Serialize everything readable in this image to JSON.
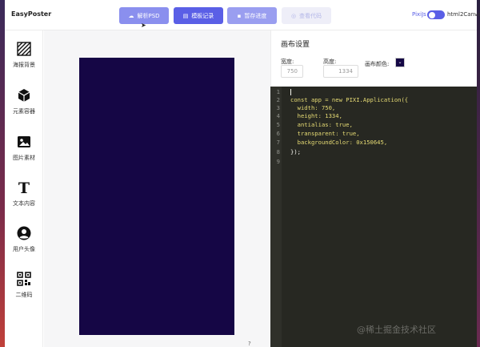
{
  "app": {
    "title": "EasyPoster"
  },
  "toolbar": {
    "parse_psd": "解析PSD",
    "templates": "模板记录",
    "save_progress": "暂存进度",
    "view_code": "查看代码",
    "mode_left": "PixiJs",
    "mode_right": "html2Canvas",
    "mode_toggle_on": true
  },
  "sidebar": {
    "items": [
      {
        "label": "海报背景",
        "icon": "stripes-icon"
      },
      {
        "label": "元素容器",
        "icon": "cube-icon"
      },
      {
        "label": "图片素材",
        "icon": "image-icon"
      },
      {
        "label": "文本内容",
        "icon": "text-icon"
      },
      {
        "label": "用户头像",
        "icon": "avatar-icon"
      },
      {
        "label": "二维码",
        "icon": "qrcode-icon"
      }
    ]
  },
  "canvas": {
    "background_color": "#150645",
    "help": "?"
  },
  "settings": {
    "title": "画布设置",
    "width_label": "宽度:",
    "width_value": "750",
    "height_label": "高度:",
    "height_value": "1334",
    "color_label": "画布颜色:",
    "color_value": "#150645"
  },
  "editor": {
    "line_numbers": [
      "1",
      "2",
      "3",
      "4",
      "5",
      "6",
      "7",
      "8",
      "9"
    ],
    "lines": [
      "",
      "const app = new PIXI.Application({",
      "  width: 750,",
      "  height: 1334,",
      "  antialias: true,",
      "  transparent: true,",
      "  backgroundColor: 0x150645,",
      "});",
      ""
    ]
  },
  "watermark": "@稀土掘金技术社区",
  "colors": {
    "accent": "#5a5fe6",
    "editor_bg": "#272822"
  }
}
